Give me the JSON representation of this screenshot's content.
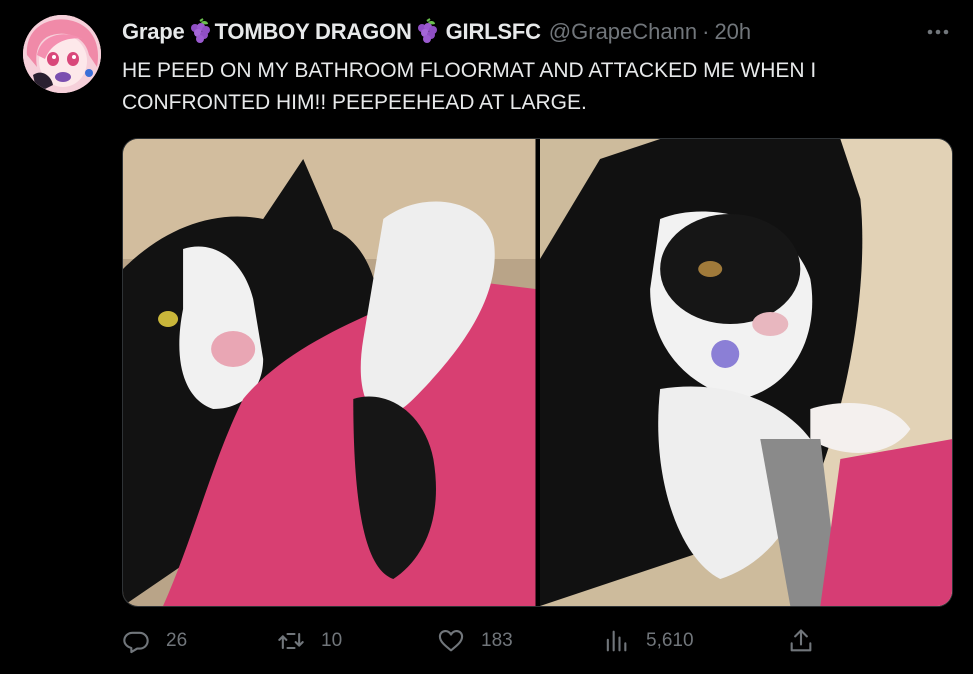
{
  "tweet": {
    "display_name_1": "Grape",
    "display_name_2": "TOMBOY DRAGON",
    "display_name_3": "GIRLSFC",
    "handle": "@GrapeChann",
    "separator": "·",
    "time": "20h",
    "text": "HE PEED ON MY BATHROOM FLOORMAT AND ATTACKED ME WHEN I CONFRONTED HIM!! PEEPEEHEAD AT LARGE."
  },
  "actions": {
    "replies": "26",
    "retweets": "10",
    "likes": "183",
    "views": "5,610"
  },
  "icons": {
    "name_emoji": "grapes-emoji",
    "more": "more-dots-icon",
    "reply": "reply-icon",
    "retweet": "retweet-icon",
    "like": "heart-icon",
    "views": "views-icon",
    "share": "share-icon"
  },
  "colors": {
    "background": "#000000",
    "text": "#e7e9ea",
    "secondary": "#71767b"
  }
}
